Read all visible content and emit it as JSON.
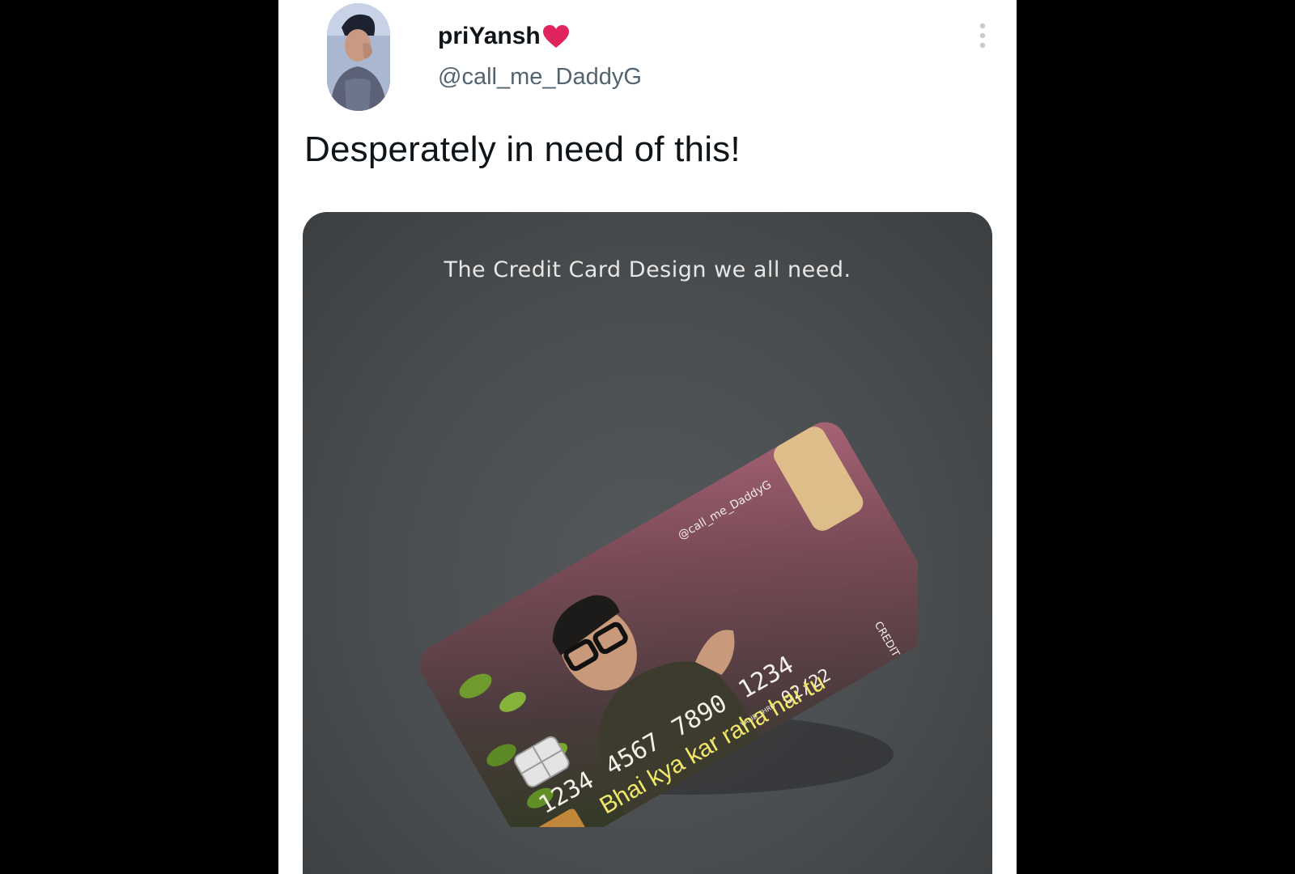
{
  "tweet": {
    "display_name": "priYansh",
    "handle": "@call_me_DaddyG",
    "text": "Desperately in need of this!",
    "more_icon": "vertical-ellipsis-icon",
    "verified_icon": "red-heart-icon"
  },
  "media": {
    "caption": "The Credit Card Design we all need.",
    "card": {
      "watermark": "@call_me_DaddyG",
      "number_group_1": "1234",
      "number_group_2": "4567",
      "number_group_3": "7890",
      "number_group_4": "1234",
      "valid_thru_label": "VALID THRU",
      "expiry": "02/22",
      "type_label": "CREDIT",
      "meme_text": "Bhai kya kar raha hai tu"
    }
  },
  "colors": {
    "background": "#000000",
    "card_bg": "#ffffff",
    "heart": "#e0245e",
    "handle": "#536471",
    "media_bg": "#4a4d4f"
  }
}
